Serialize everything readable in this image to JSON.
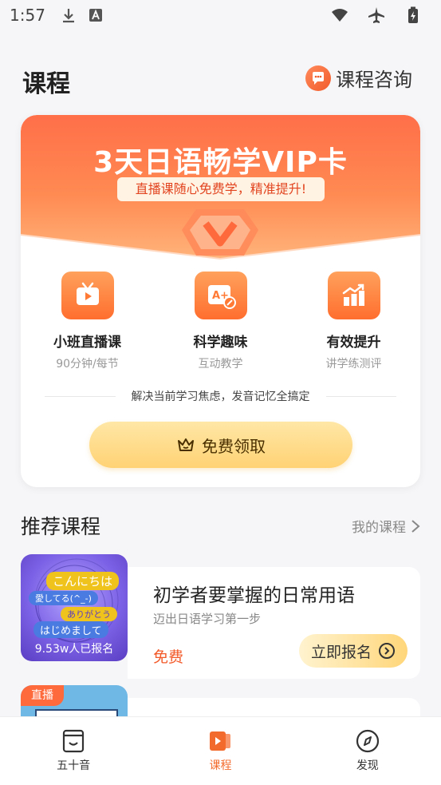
{
  "status_bar": {
    "time": "1:57"
  },
  "header": {
    "title": "课程",
    "consult_label": "课程咨询"
  },
  "vip_card": {
    "title": "3天日语畅学VIP卡",
    "subtitle": "直播课随心免费学，精准提升!",
    "features": [
      {
        "name": "小班直播课",
        "desc": "90分钟/每节",
        "icon": "tv-play-icon"
      },
      {
        "name": "科学趣味",
        "desc": "互动教学",
        "icon": "card-pen-icon"
      },
      {
        "name": "有效提升",
        "desc": "讲学练测评",
        "icon": "bar-chart-up-icon"
      }
    ],
    "slogan": "解决当前学习焦虑，发音记忆全搞定",
    "claim_label": "免费领取"
  },
  "recommend": {
    "title": "推荐课程",
    "my_courses_label": "我的课程",
    "courses": [
      {
        "thumb_tags": [
          "こんにちは",
          "愛してる(^_-)",
          "ありがとう",
          "はじめまして"
        ],
        "enroll_count": "9.53w人已报名",
        "name": "初学者要掌握的日常用语",
        "desc": "迈出日语学习第一步",
        "price": "免费",
        "signup_label": "立即报名"
      },
      {
        "live_tag": "直播"
      }
    ]
  },
  "bottom_nav": {
    "items": [
      {
        "label": "五十音",
        "icon": "book-icon",
        "active": false
      },
      {
        "label": "课程",
        "icon": "course-play-icon",
        "active": true
      },
      {
        "label": "发现",
        "icon": "compass-icon",
        "active": false
      }
    ]
  },
  "colors": {
    "accent": "#f36b2c",
    "vip_gradient_top": "#ff6f49",
    "button_gold": "#ffd274"
  }
}
